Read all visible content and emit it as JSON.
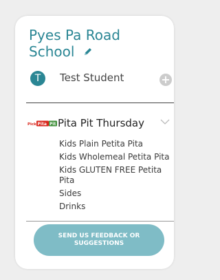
{
  "school": {
    "name": "Pyes Pa Road School"
  },
  "student": {
    "initial": "T",
    "name": "Test Student"
  },
  "menu": {
    "logo_text": "PickPitaPit",
    "title": "Pita Pit Thursday",
    "items": [
      "Kids Plain Petita Pita",
      "Kids Wholemeal Petita Pita",
      "Kids GLUTEN FREE Petita Pita",
      "Sides",
      "Drinks"
    ]
  },
  "feedback": {
    "label": "SEND US FEEDBACK OR SUGGESTIONS"
  },
  "colors": {
    "accent": "#2a8694",
    "button": "#7fbcc6",
    "logo_red": "#d9261c",
    "logo_green": "#3f8f3a"
  }
}
